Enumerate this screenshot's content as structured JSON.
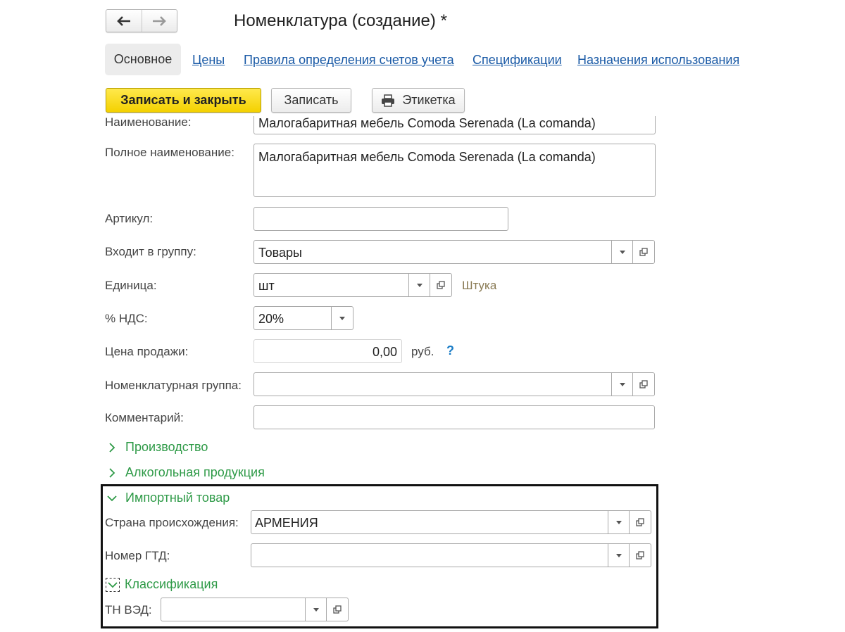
{
  "header": {
    "title": "Номенклатура (создание) *"
  },
  "nav": {
    "back_icon": "arrow-left-icon",
    "forward_icon": "arrow-right-icon"
  },
  "tabs": [
    {
      "label": "Основное",
      "active": true
    },
    {
      "label": "Цены"
    },
    {
      "label": "Правила определения счетов учета"
    },
    {
      "label": "Спецификации"
    },
    {
      "label": "Назначения использования"
    }
  ],
  "toolbar": {
    "save_close": "Записать и закрыть",
    "save": "Записать",
    "label_btn": "Этикетка",
    "label_icon": "printer-icon"
  },
  "form": {
    "name": {
      "label": "Наименование:",
      "value": "Малогабаритная мебель Comoda Serenada (La comanda)"
    },
    "full_name": {
      "label": "Полное наименование:",
      "value": "Малогабаритная мебель Comoda Serenada (La comanda)"
    },
    "article": {
      "label": "Артикул:",
      "value": ""
    },
    "group": {
      "label": "Входит в группу:",
      "value": "Товары"
    },
    "unit": {
      "label": "Единица:",
      "value": "шт",
      "hint": "Штука"
    },
    "vat": {
      "label": "% НДС:",
      "value": "20%"
    },
    "price": {
      "label": "Цена продажи:",
      "value": "0,00",
      "currency": "руб.",
      "help": "?"
    },
    "nomenclature_group": {
      "label": "Номенклатурная группа:",
      "value": ""
    },
    "comment": {
      "label": "Комментарий:",
      "value": ""
    }
  },
  "sections": {
    "production": "Производство",
    "alcohol": "Алкогольная продукция",
    "imported": "Импортный товар",
    "classification": "Классификация"
  },
  "imported": {
    "country": {
      "label": "Страна происхождения:",
      "value": "АРМЕНИЯ"
    },
    "gtd": {
      "label": "Номер ГТД:",
      "value": ""
    },
    "tnved": {
      "label": "ТН ВЭД:",
      "value": ""
    }
  },
  "colors": {
    "accent_yellow": "#f7d900",
    "link_blue": "#1a5aa6",
    "section_green": "#2e9a47"
  }
}
